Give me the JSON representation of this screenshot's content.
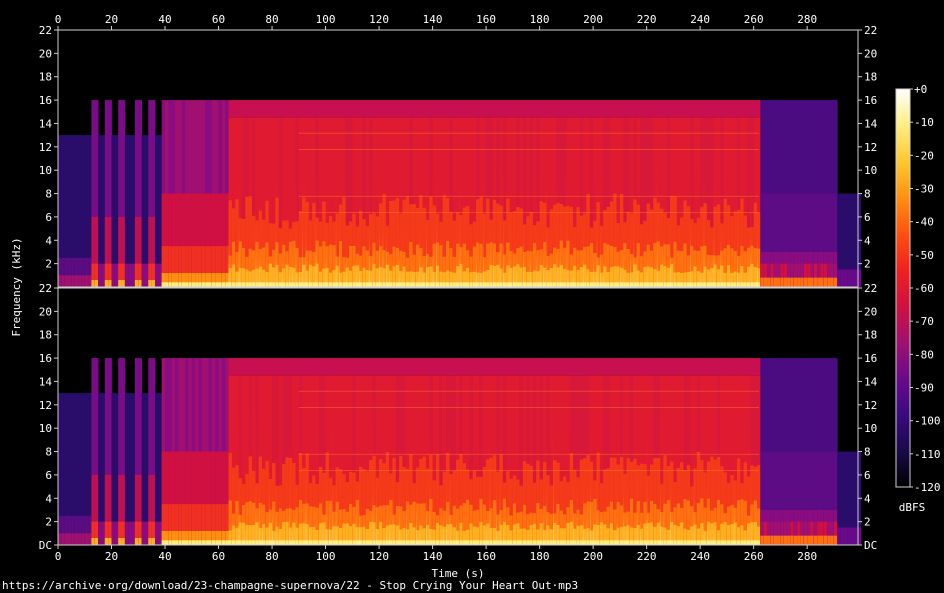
{
  "chart_data": {
    "type": "heatmap",
    "xlabel": "Time (s)",
    "ylabel": "Frequency (kHz)",
    "x_ticks": [
      "0",
      "20",
      "40",
      "60",
      "80",
      "100",
      "120",
      "140",
      "160",
      "180",
      "200",
      "220",
      "240",
      "260",
      "280"
    ],
    "x_tick_values": [
      0,
      20,
      40,
      60,
      80,
      100,
      120,
      140,
      160,
      180,
      200,
      220,
      240,
      260,
      280
    ],
    "xlim": [
      0,
      299
    ],
    "y_ticks_top": [
      "22",
      "20",
      "18",
      "16",
      "14",
      "12",
      "10",
      "8",
      "6",
      "4",
      "2"
    ],
    "y_ticks_bottom": [
      "22",
      "20",
      "18",
      "16",
      "14",
      "12",
      "10",
      "8",
      "6",
      "4",
      "2",
      "DC"
    ],
    "y_tick_values": [
      22,
      20,
      18,
      16,
      14,
      12,
      10,
      8,
      6,
      4,
      2,
      0
    ],
    "ylim": [
      0,
      22
    ],
    "channels": 2,
    "colorbar": {
      "label": "dBFS",
      "ticks": [
        "+0",
        "-10",
        "-20",
        "-30",
        "-40",
        "-50",
        "-60",
        "-70",
        "-80",
        "-90",
        "-100",
        "-110",
        "-120"
      ],
      "tick_values": [
        0,
        -10,
        -20,
        -30,
        -40,
        -50,
        -60,
        -70,
        -80,
        -90,
        -100,
        -110,
        -120
      ],
      "range": [
        -120,
        0
      ],
      "colors": [
        "#000000",
        "#1a0a4a",
        "#3a0a80",
        "#6a0a8a",
        "#a01070",
        "#d01040",
        "#f02020",
        "#ff5010",
        "#ff9010",
        "#ffc830",
        "#ffee80",
        "#ffffff"
      ]
    },
    "segments": [
      {
        "t0": 0,
        "t1": 12,
        "kind": "intro"
      },
      {
        "t0": 12,
        "t1": 38,
        "kind": "stutter"
      },
      {
        "t0": 38,
        "t1": 63,
        "kind": "build"
      },
      {
        "t0": 63,
        "t1": 262,
        "kind": "full",
        "cutoff_khz": 16
      },
      {
        "t0": 262,
        "t1": 291,
        "kind": "fade",
        "cutoff_khz": 16
      },
      {
        "t0": 291,
        "t1": 299,
        "kind": "tail"
      }
    ]
  },
  "source_url": "https://archive·org/download/23-champagne-supernova/22 - Stop Crying Your Heart Out·mp3"
}
